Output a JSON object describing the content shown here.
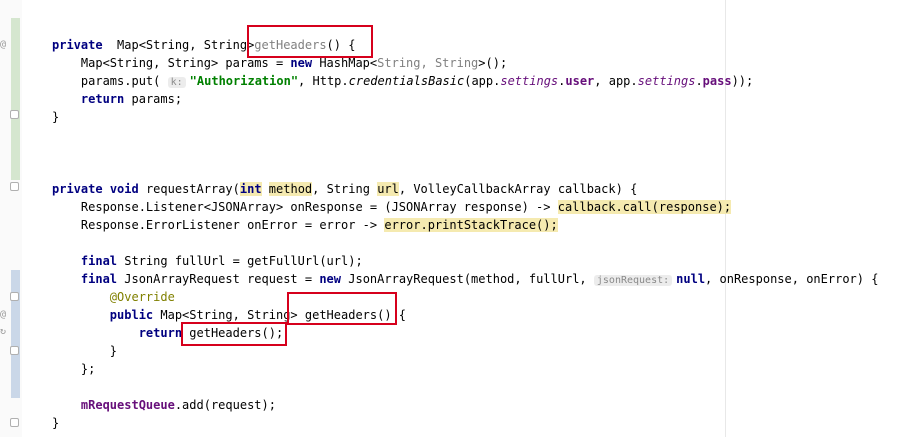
{
  "code": {
    "l_get_headers_decl": {
      "kw_private": "private",
      "type": "  Map<String, String>",
      "method": "getHeaders",
      "rest": "() {"
    },
    "l_map_decl": {
      "type": "Map<String, String> params = ",
      "kw_new": "new",
      "class": " HashMap<",
      "generic": "String, String",
      "rest": ">();"
    },
    "l_put": {
      "start": "params.put(",
      "hint": "k:",
      "key": "\"Authorization\"",
      "mid1": ", Http.",
      "call": "credentialsBasic",
      "mid2": "(app.",
      "settings1": "settings",
      "dot1": ".",
      "user": "user",
      "mid3": ", app.",
      "settings2": "settings",
      "dot2": ".",
      "pass": "pass",
      "end": "));"
    },
    "l_return_params": {
      "kw": "return",
      "rest": " params;"
    },
    "l_close1": "}",
    "l_request_array": {
      "kw1": "private",
      "kw2": "void",
      "name": " requestArray(",
      "kw3": "int",
      "p1": "method",
      "s1": ", String ",
      "p2": "url",
      "s2": ", VolleyCallbackArray callback) {"
    },
    "l_listener": {
      "text": "Response.Listener<JSONArray> onResponse = (JSONArray response) -> ",
      "hl": "callback.call(response);"
    },
    "l_error_listener": {
      "text": "Response.ErrorListener onError = error -> ",
      "hl": "error.printStackTrace();"
    },
    "l_full_url": {
      "kw": "final",
      "rest": " String fullUrl = getFullUrl(url);"
    },
    "l_json_request": {
      "kw1": "final",
      "a": " JsonArrayRequest request = ",
      "kw2": "new",
      "b": " JsonArrayRequest(method, fullUrl, ",
      "hint": "jsonRequest:",
      "kw3": "null",
      "c": ", onResponse, onError) {"
    },
    "l_override": "@Override",
    "l_public_map": {
      "kw": "public",
      "rest": " Map<String, String> getHeaders() {"
    },
    "l_return_headers": {
      "kw": "return",
      "rest": " getHeaders();"
    },
    "l_close_inner": "}",
    "l_close_anon": "};",
    "l_add": {
      "field": "mRequestQueue",
      "rest": ".add(request);"
    },
    "l_close2": "}"
  },
  "annotations": {
    "callout_color": "#d6001c"
  }
}
